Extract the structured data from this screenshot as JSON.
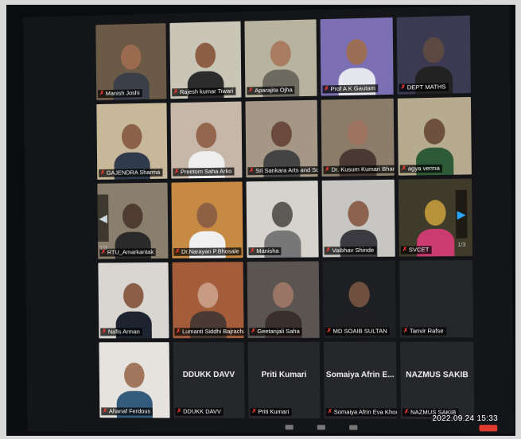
{
  "participants": [
    {
      "name": "Manish Joshi",
      "tone": "#6b5a45",
      "skin": "#9a6b4f",
      "shirt": "#3b3f4a",
      "active": false
    },
    {
      "name": "Rajesh kumar Tiwari",
      "tone": "#c9c6b8",
      "skin": "#8c5f45",
      "shirt": "#2c2c2c",
      "active": false
    },
    {
      "name": "Aparajita Ojha",
      "tone": "#b7b39e",
      "skin": "#a87c61",
      "shirt": "#6d6b60",
      "active": true
    },
    {
      "name": "Prof A K Gautam",
      "tone": "#7c6fb3",
      "skin": "#9b6d55",
      "shirt": "#e6e6ee",
      "active": false
    },
    {
      "name": "DEPT MATHS",
      "tone": "#3c3a52",
      "skin": "#5c4a42",
      "shirt": "#222",
      "active": false
    },
    {
      "name": "GAJENDRA Sharma",
      "tone": "#c8b89a",
      "skin": "#8b6248",
      "shirt": "#2f3b4a",
      "active": false
    },
    {
      "name": "Preetom Saha Arko",
      "tone": "#c7b7a8",
      "skin": "#93674d",
      "shirt": "#eee",
      "active": false
    },
    {
      "name": "Sri Sankara Arts and Science...",
      "tone": "#a59785",
      "skin": "#6b4a3c",
      "shirt": "#444",
      "active": false
    },
    {
      "name": "Dr. Kusum Kumari Bharti",
      "tone": "#8c7d6a",
      "skin": "#9f7460",
      "shirt": "#493a34",
      "active": false
    },
    {
      "name": "agya verma",
      "tone": "#b6ab8e",
      "skin": "#6e503e",
      "shirt": "#2d5a37",
      "active": false
    },
    {
      "name": "RTU_Amarkantak",
      "tone": "#8a7f6c",
      "skin": "#4e3b32",
      "shirt": "#2a2a2a",
      "active": false
    },
    {
      "name": "Dr.Narayan P.Bhosale",
      "tone": "#c78a43",
      "skin": "#8f6144",
      "shirt": "#f0f0f0",
      "active": false
    },
    {
      "name": "Manisha",
      "tone": "#d6d3cc",
      "skin": "#5c5a57",
      "shirt": "#777",
      "active": false
    },
    {
      "name": "Vaibhav Shinde",
      "tone": "#c8c6c2",
      "skin": "#8d6350",
      "shirt": "#3a3a40",
      "active": false
    },
    {
      "name": "SVCET",
      "tone": "#3f3b2b",
      "skin": "#b8923a",
      "shirt": "#cc3b6f",
      "active": false
    },
    {
      "name": "Nafis Arman",
      "tone": "#d9d6d2",
      "skin": "#8b5f45",
      "shirt": "#1d2430",
      "active": false
    },
    {
      "name": "Lumanti Siddhi Bajracharya",
      "tone": "#a35d3b",
      "skin": "#c79a82",
      "shirt": "#4a3a33",
      "active": false
    },
    {
      "name": "Geetanjali Saha",
      "tone": "#5a5550",
      "skin": "#9b7565",
      "shirt": "#3a2f2c",
      "active": false
    },
    {
      "name": "MD SOAIB SULTAN",
      "tone": "#1e1f22",
      "skin": "#6f4f3e",
      "shirt": "#1f1f22",
      "active": false
    },
    {
      "name": "Tanvir Rafse",
      "tone": "#25262a",
      "skin": "#25262a",
      "shirt": "#25262a",
      "active": false
    },
    {
      "name": "Ahanaf Ferdous",
      "tone": "#e6e3de",
      "skin": "#a0765d",
      "shirt": "#335a7a",
      "active": false
    },
    {
      "name": "DDUKK DAVV",
      "center": "DDUKK DAVV",
      "active": false
    },
    {
      "name": "Priti Kumari",
      "center": "Priti Kumari",
      "active": false
    },
    {
      "name": "Somaiya Afrin Eva Khondo...",
      "center": "Somaiya Afrin E...",
      "active": false
    },
    {
      "name": "NAZMUS SAKIB",
      "center": "NAZMUS SAKIB",
      "active": false
    }
  ],
  "pagination": {
    "left": "1/3",
    "right": "1/3"
  },
  "timestamp": "2022.09.24 15:33",
  "colors": {
    "active_speaker": "#c9e31a",
    "mic_off": "#ff3b30",
    "nav_arrow": "#29a7ff"
  }
}
